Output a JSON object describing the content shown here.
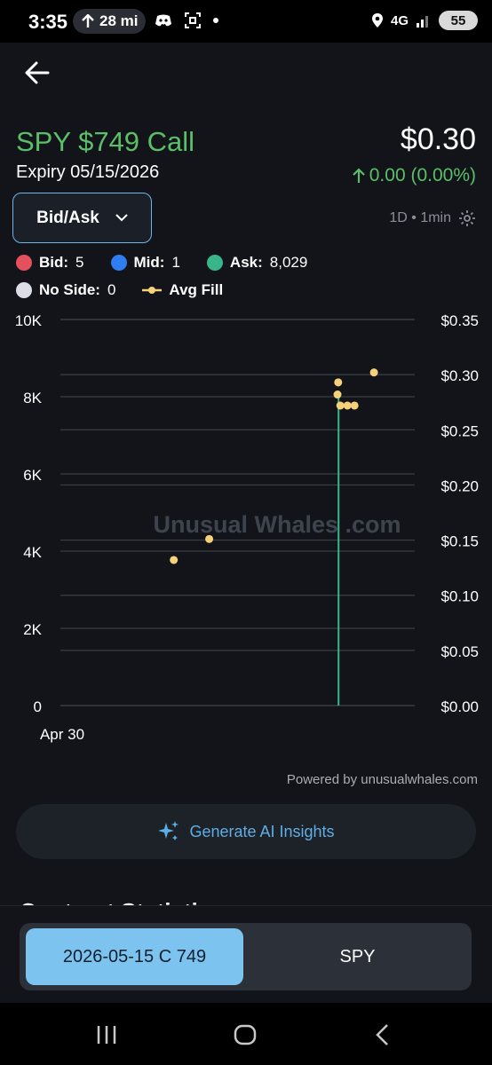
{
  "status_bar": {
    "time": "3:35",
    "nav_distance": "28 mi",
    "network": "4G",
    "battery": "55"
  },
  "option": {
    "title": "SPY $749 Call",
    "expiry": "Expiry 05/15/2026",
    "price": "$0.30",
    "change": "0.00 (0.00%)"
  },
  "controls": {
    "dropdown_label": "Bid/Ask",
    "timeframe": "1D • 1min"
  },
  "legend": [
    {
      "label": "Bid:",
      "value": "5",
      "color": "#e5505f"
    },
    {
      "label": "Mid:",
      "value": "1",
      "color": "#2f7df0"
    },
    {
      "label": "Ask:",
      "value": "8,029",
      "color": "#38b58a"
    },
    {
      "label": "No Side:",
      "value": "0",
      "color": "#dcdfe6"
    },
    {
      "label": "Avg Fill",
      "value": "",
      "color": "#f5d27a"
    }
  ],
  "chart_data": {
    "type": "bar",
    "watermark": "Unusual Whales .com",
    "x_tick_labels": [
      "Apr 30"
    ],
    "left_axis": {
      "ticks": [
        "10K",
        "8K",
        "6K",
        "4K",
        "2K",
        "0"
      ],
      "range": [
        0,
        10000
      ]
    },
    "right_axis": {
      "ticks": [
        "$0.35",
        "$0.30",
        "$0.25",
        "$0.20",
        "$0.15",
        "$0.10",
        "$0.05",
        "$0.00"
      ],
      "range": [
        0,
        0.35
      ]
    },
    "volume_bars": [
      {
        "t": 0.785,
        "value": 8029,
        "color": "#38b58a"
      }
    ],
    "avg_fill_points": [
      {
        "t": 0.32,
        "price": 0.132
      },
      {
        "t": 0.42,
        "price": 0.151
      },
      {
        "t": 0.784,
        "price": 0.293
      },
      {
        "t": 0.782,
        "price": 0.282
      },
      {
        "t": 0.79,
        "price": 0.272
      },
      {
        "t": 0.81,
        "price": 0.272
      },
      {
        "t": 0.83,
        "price": 0.272
      },
      {
        "t": 0.885,
        "price": 0.302
      }
    ]
  },
  "footer": {
    "powered_by": "Powered by unusualwhales.com",
    "ai_button": "Generate AI Insights",
    "section_title": "Contract Statistics",
    "segment_active": "2026-05-15 C 749",
    "segment_other": "SPY"
  }
}
